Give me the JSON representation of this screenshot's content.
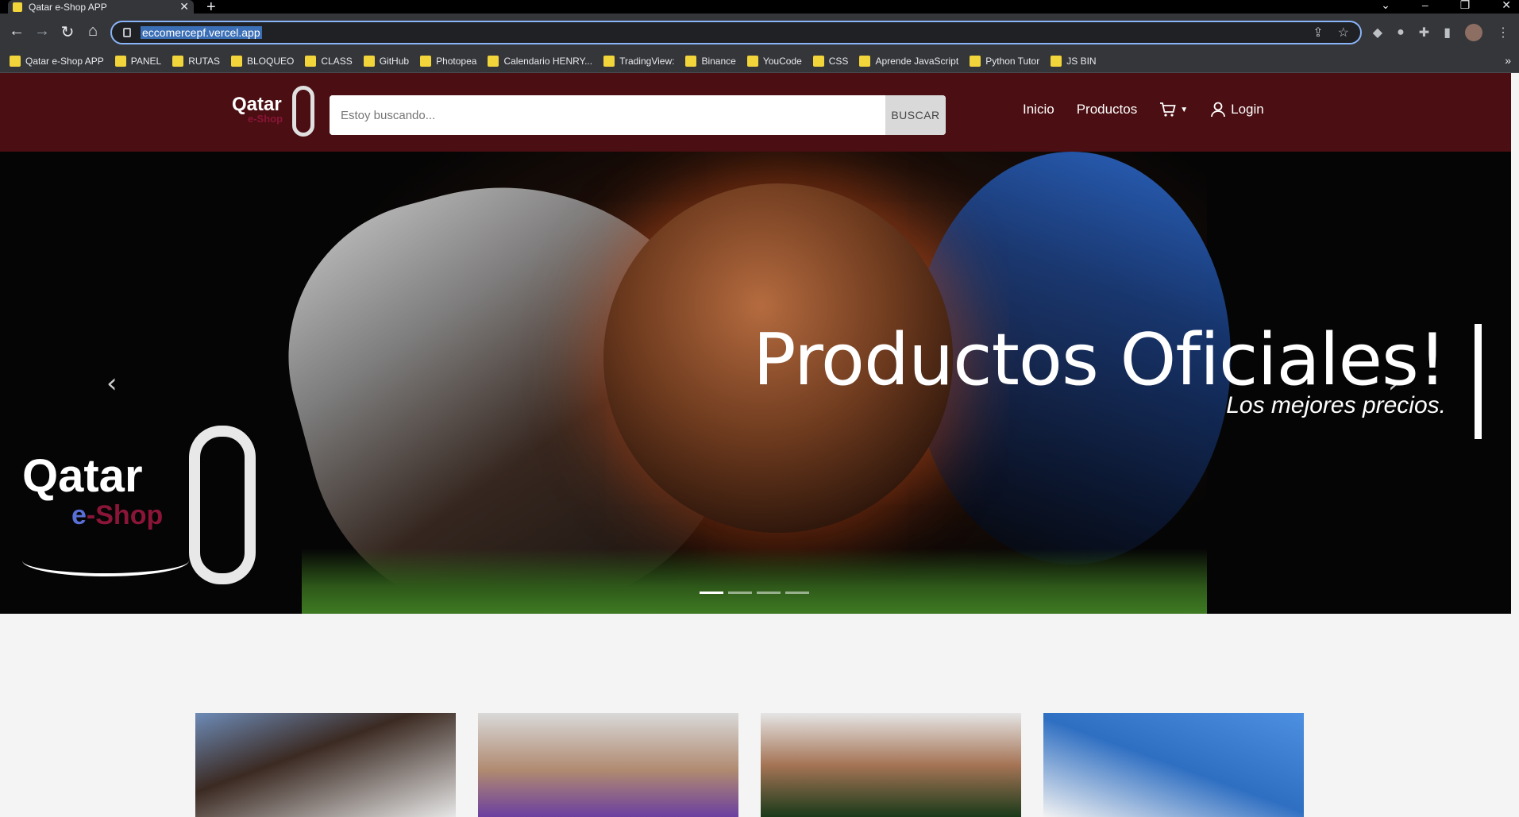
{
  "browser": {
    "tab_title": "Qatar e-Shop APP",
    "url": "eccomercepf.vercel.app",
    "bookmarks": [
      "Qatar e-Shop APP",
      "PANEL",
      "RUTAS",
      "BLOQUEO",
      "CLASS",
      "GitHub",
      "Photopea",
      "Calendario HENRY...",
      "TradingView:",
      "Binance",
      "YouCode",
      "CSS",
      "Aprende JavaScript",
      "Python Tutor",
      "JS BIN"
    ]
  },
  "header": {
    "logo_title": "Qatar",
    "logo_sub": "e-Shop",
    "search_placeholder": "Estoy buscando...",
    "search_button": "BUSCAR",
    "nav_home": "Inicio",
    "nav_products": "Productos",
    "nav_login": "Login"
  },
  "hero": {
    "title": "Productos Oficiales!",
    "subtitle": "Los mejores precios.",
    "logo_title": "Qatar",
    "logo_sub_e": "e",
    "logo_sub_rest": "Shop",
    "indicators": 4,
    "active_index": 0
  },
  "products": {
    "cards": [
      {
        "icon": "player-photo-germany"
      },
      {
        "icon": "player-photo-messi"
      },
      {
        "icon": "player-photo-neymar"
      },
      {
        "icon": "player-photo-ball"
      }
    ]
  },
  "colors": {
    "header_bg": "#4b0e12",
    "brand_maroon": "#8a1538"
  }
}
